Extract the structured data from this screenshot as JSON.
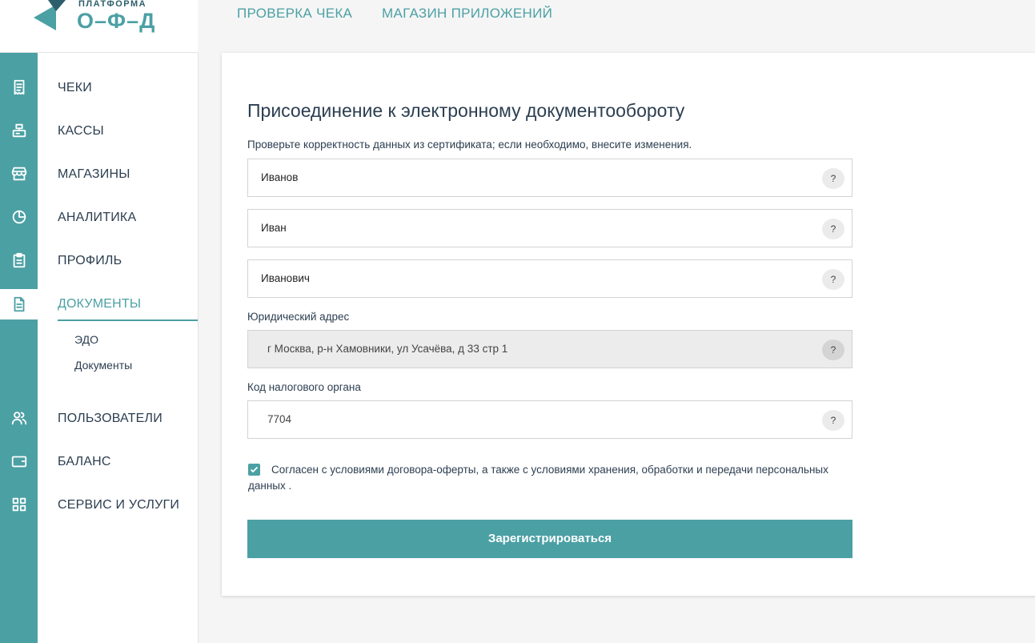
{
  "logo": {
    "top_text": "ПЛАТФОРМА",
    "main_text": "О–Ф–Д"
  },
  "header": {
    "links": [
      "ПРОВЕРКА ЧЕКА",
      "МАГАЗИН ПРИЛОЖЕНИЙ"
    ]
  },
  "nav": {
    "items": [
      {
        "label": "ЧЕКИ",
        "icon": "receipt-icon"
      },
      {
        "label": "КАССЫ",
        "icon": "cash-register-icon"
      },
      {
        "label": "МАГАЗИНЫ",
        "icon": "store-icon"
      },
      {
        "label": "АНАЛИТИКА",
        "icon": "pie-chart-icon"
      },
      {
        "label": "ПРОФИЛЬ",
        "icon": "clipboard-icon"
      },
      {
        "label": "ДОКУМЕНТЫ",
        "icon": "document-icon"
      },
      {
        "label": "ПОЛЬЗОВАТЕЛИ",
        "icon": "users-icon"
      },
      {
        "label": "БАЛАНС",
        "icon": "wallet-icon"
      },
      {
        "label": "СЕРВИС И УСЛУГИ",
        "icon": "grid-icon"
      }
    ],
    "sub_items": [
      "ЭДО",
      "Документы"
    ]
  },
  "form": {
    "title": "Присоединение к электронному документообороту",
    "subtitle": "Проверьте корректность данных из сертификата; если необходимо, внесите изменения.",
    "last_name": "Иванов",
    "first_name": "Иван",
    "middle_name": "Иванович",
    "address_label": "Юридический адрес",
    "address_value": "г Москва, р-н Хамовники, ул Усачёва, д 33 стр 1",
    "tax_label": "Код налогового органа",
    "tax_value": "7704",
    "help": "?",
    "agree_text": "Согласен с условиями договора-оферты, а также с условиями хранения, обработки и передачи персональных данных .",
    "agree_checked": true,
    "submit_label": "Зарегистрироваться"
  },
  "colors": {
    "accent": "#4ba0a4",
    "text": "#2c3e50"
  }
}
